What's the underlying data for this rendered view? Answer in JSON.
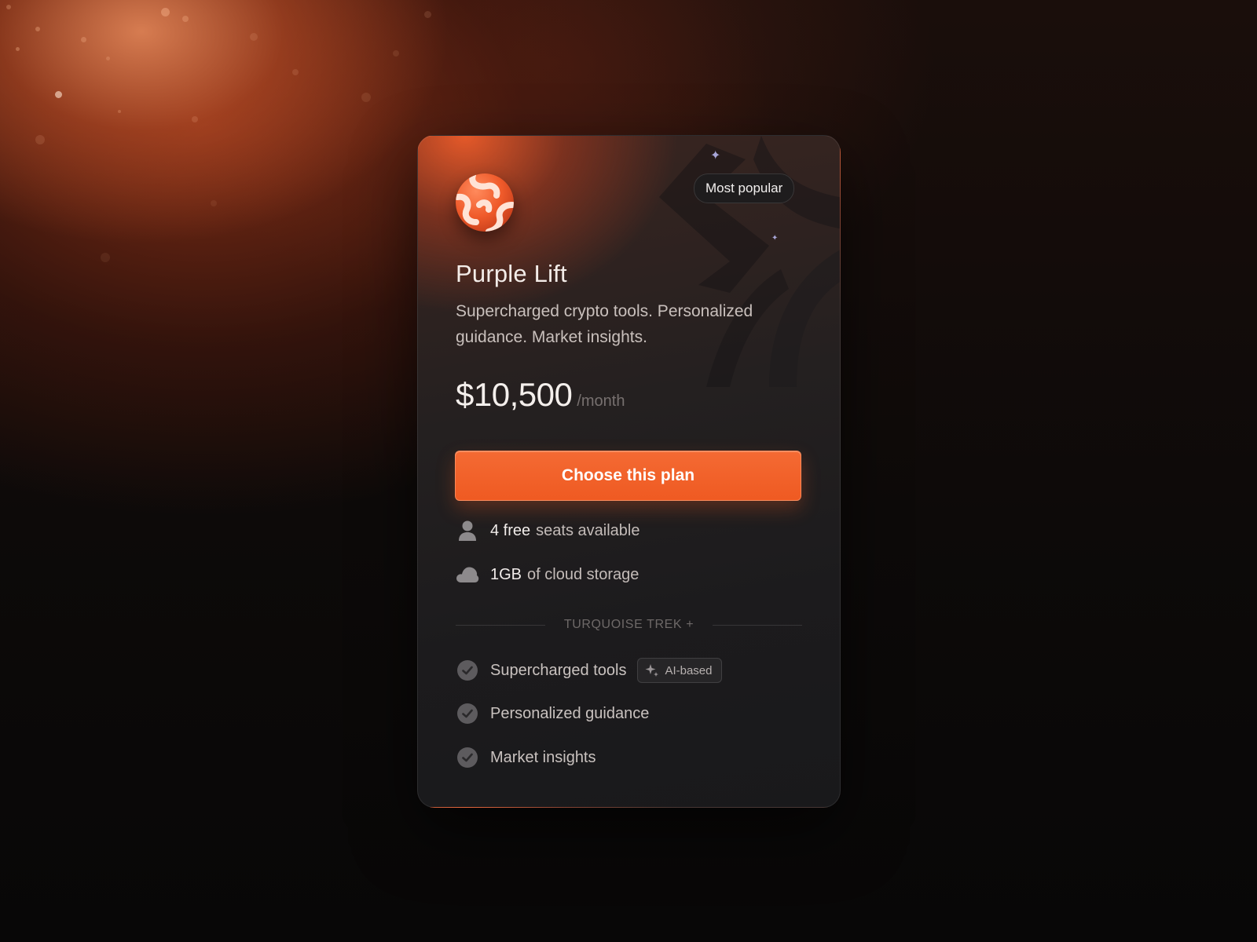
{
  "plan_card": {
    "badge": "Most popular",
    "title": "Purple Lift",
    "description": "Supercharged crypto tools. Personalized guidance. Market insights.",
    "price": "$10,500",
    "period": "/month",
    "cta_label": "Choose this plan",
    "seats": {
      "strong": "4 free",
      "text": "seats available",
      "icon": "user-icon"
    },
    "storage": {
      "strong": "1GB",
      "text": "of cloud storage",
      "icon": "cloud-icon"
    },
    "section_label": "TURQUOISE TREK +",
    "features": [
      {
        "label": "Supercharged tools",
        "tag": "AI-based",
        "icon": "check-circle-icon",
        "tag_icon": "sparkle-icon"
      },
      {
        "label": "Personalized guidance",
        "icon": "check-circle-icon"
      },
      {
        "label": "Market insights",
        "icon": "check-circle-icon"
      }
    ]
  },
  "colors": {
    "accent": "#f05f28",
    "card_background": "#1c1b1d",
    "background": "#0a0909",
    "text_primary": "#f3ece8",
    "text_muted": "#77706f"
  }
}
